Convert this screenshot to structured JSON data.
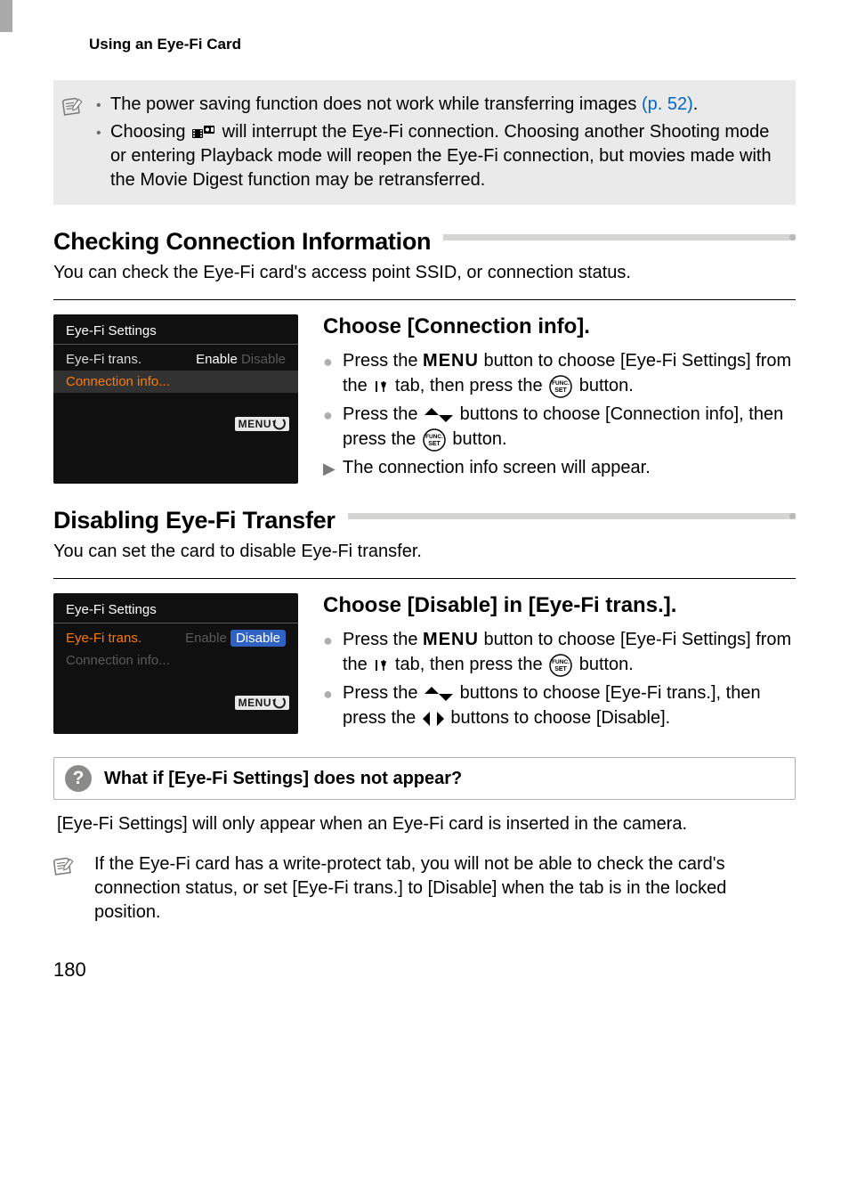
{
  "header": "Using an Eye-Fi Card",
  "note1": {
    "line1_a": "The power saving function does not work while transferring images ",
    "line1_link": "(p. 52)",
    "line1_b": ".",
    "line2_a": "Choosing ",
    "line2_b": " will interrupt the Eye-Fi connection. Choosing another Shooting mode or entering Playback mode will reopen the Eye-Fi connection, but movies made with the Movie Digest function may be retransferred."
  },
  "sectionA": {
    "heading": "Checking Connection Information",
    "intro": "You can check the Eye-Fi card's access point SSID, or connection status.",
    "lcd": {
      "title": "Eye-Fi Settings",
      "row1_label": "Eye-Fi trans.",
      "row1_val_enable": "Enable",
      "row1_val_disable": "Disable",
      "row2_label": "Connection info...",
      "footer": "MENU"
    },
    "step_title": "Choose [Connection info].",
    "s1_a": "Press the ",
    "s1_b": " button to choose [Eye-Fi Settings] from the ",
    "s1_c": " tab, then press the ",
    "s1_d": " button.",
    "s2_a": "Press the ",
    "s2_b": " buttons to choose [Connection info], then press the ",
    "s2_c": " button.",
    "s3": "The connection info screen will appear."
  },
  "sectionB": {
    "heading": "Disabling Eye-Fi Transfer",
    "intro": "You can set the card to disable Eye-Fi transfer.",
    "lcd": {
      "title": "Eye-Fi Settings",
      "row1_label": "Eye-Fi trans.",
      "row1_val_enable": "Enable",
      "row1_val_disable": "Disable",
      "row2_label": "Connection info...",
      "footer": "MENU"
    },
    "step_title": "Choose [Disable] in [Eye-Fi trans.].",
    "s1_a": "Press the ",
    "s1_b": " button to choose [Eye-Fi Settings] from the ",
    "s1_c": " tab, then press the ",
    "s1_d": " button.",
    "s2_a": "Press the ",
    "s2_b": " buttons to choose [Eye-Fi trans.], then press the ",
    "s2_c": " buttons to choose [Disable]."
  },
  "tip": {
    "title": "What if [Eye-Fi Settings] does not appear?",
    "answer": "[Eye-Fi Settings] will only appear when an Eye-Fi card is inserted in the camera."
  },
  "final_note": "If the Eye-Fi card has a write-protect tab, you will not be able to check the card's connection status, or set [Eye-Fi trans.] to [Disable] when the tab is in the locked position.",
  "page_number": "180",
  "glyphs": {
    "menu_text": "MENU",
    "funcset_text": "FUNC.\nSET"
  }
}
